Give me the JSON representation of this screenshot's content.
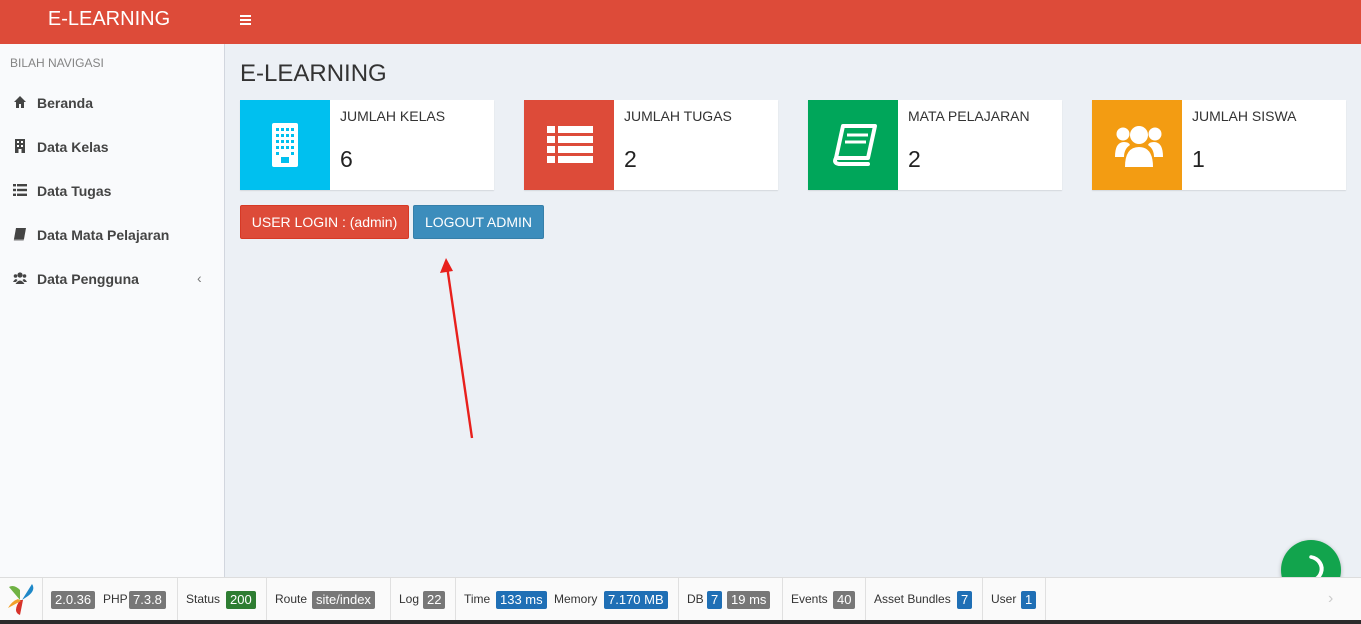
{
  "header": {
    "logo": "E-LEARNING"
  },
  "sidebar": {
    "heading": "BILAH NAVIGASI",
    "items": [
      {
        "label": "Beranda",
        "icon": "home-icon"
      },
      {
        "label": "Data Kelas",
        "icon": "building-icon"
      },
      {
        "label": "Data Tugas",
        "icon": "list-icon"
      },
      {
        "label": "Data Mata Pelajaran",
        "icon": "book-icon"
      },
      {
        "label": "Data Pengguna",
        "icon": "users-icon",
        "chevron": "‹"
      }
    ]
  },
  "main": {
    "title": "E-LEARNING",
    "boxes": [
      {
        "label": "JUMLAH KELAS",
        "value": "6",
        "color": "#00c0ef",
        "icon": "building-icon"
      },
      {
        "label": "JUMLAH TUGAS",
        "value": "2",
        "color": "#dd4b39",
        "icon": "list-icon"
      },
      {
        "label": "MATA PELAJARAN",
        "value": "2",
        "color": "#00a65a",
        "icon": "book-icon"
      },
      {
        "label": "JUMLAH SISWA",
        "value": "1",
        "color": "#f39c12",
        "icon": "users-icon"
      }
    ],
    "user_login_label": "USER LOGIN : (admin)",
    "logout_label": "LOGOUT ADMIN"
  },
  "debug": {
    "yii_version": "2.0.36",
    "php_label": "PHP",
    "php_version": "7.3.8",
    "status_label": "Status",
    "status_value": "200",
    "route_label": "Route",
    "route_value": "site/index",
    "log_label": "Log",
    "log_value": "22",
    "time_label": "Time",
    "time_value": "133 ms",
    "memory_label": "Memory",
    "memory_value": "7.170 MB",
    "db_label": "DB",
    "db_queries": "7",
    "db_time": "19 ms",
    "events_label": "Events",
    "events_value": "40",
    "assets_label": "Asset Bundles",
    "assets_value": "7",
    "user_label": "User",
    "user_value": "1",
    "next": "›"
  },
  "colors": {
    "header": "#dd4b39",
    "chat": "#12a44d"
  }
}
